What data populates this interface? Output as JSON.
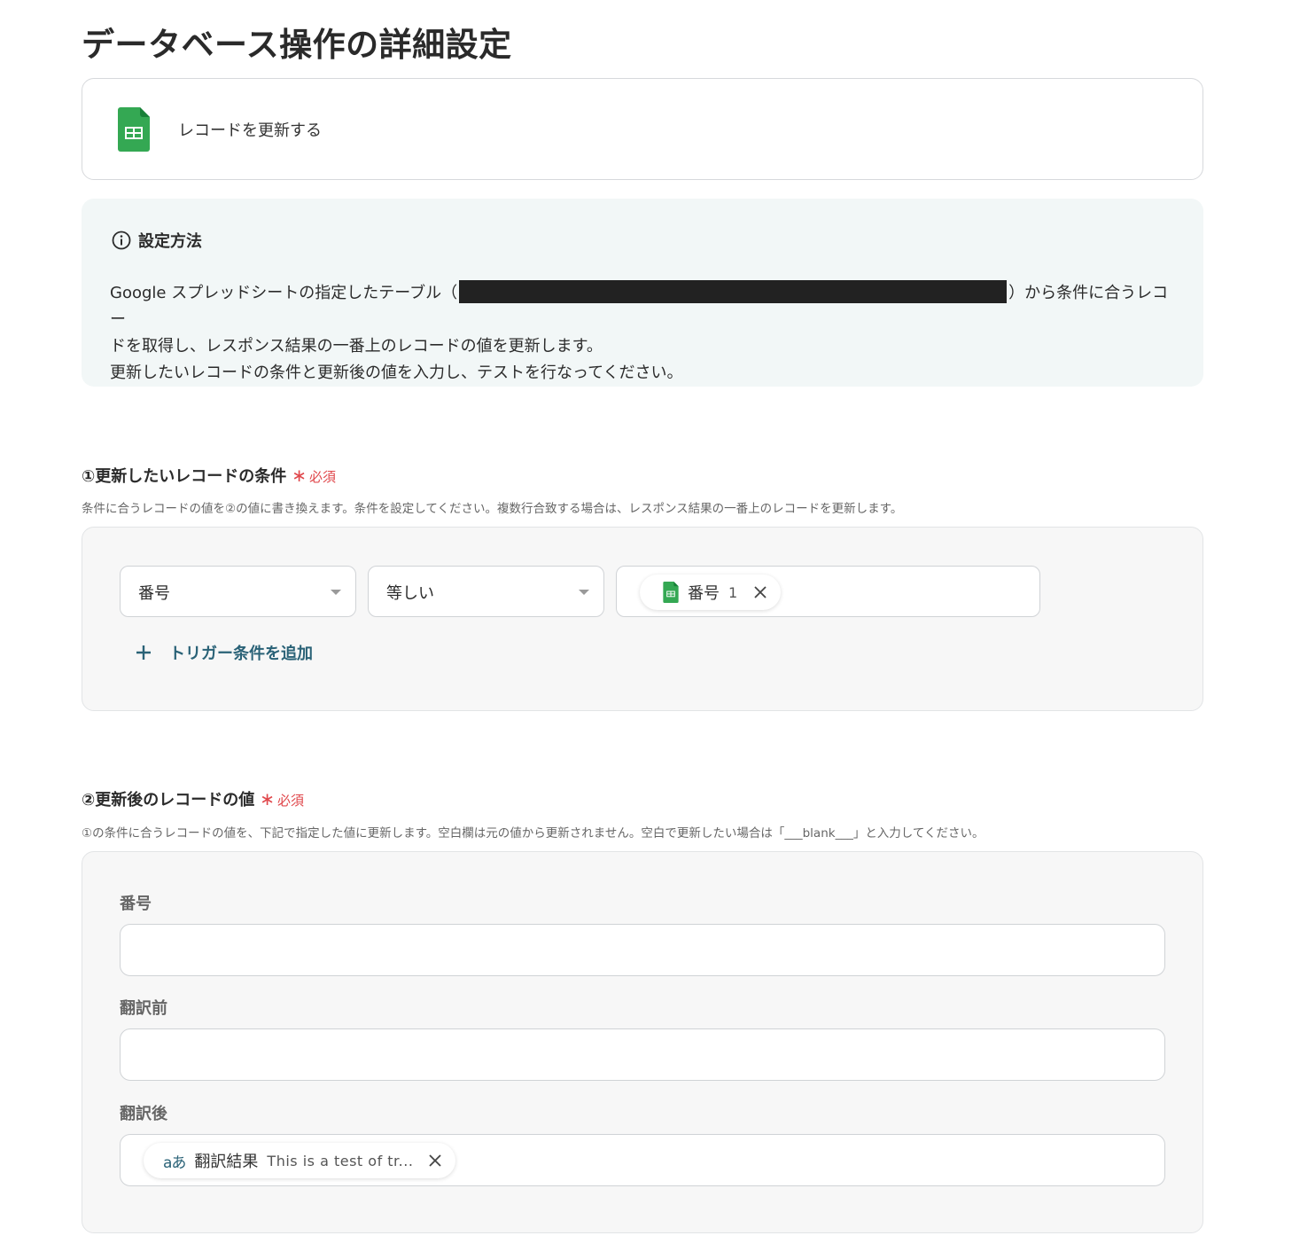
{
  "page": {
    "title": "データベース操作の詳細設定"
  },
  "action": {
    "label": "レコードを更新する",
    "icon": "google-sheets-icon"
  },
  "info": {
    "title": "設定方法",
    "line1_before": "Google スプレッドシートの指定したテーブル（",
    "line1_after": "）から条件に合うレコー",
    "line2": "ドを取得し、レスポンス結果の一番上のレコードの値を更新します。",
    "line3": "更新したいレコードの条件と更新後の値を入力し、テストを行なってください。"
  },
  "section1": {
    "title": "①更新したいレコードの条件",
    "required_star": "∗",
    "required": "必須",
    "description": "条件に合うレコードの値を②の値に書き換えます。条件を設定してください。複数行合致する場合は、レスポンス結果の一番上のレコードを更新します。",
    "condition": {
      "field": "番号",
      "operator": "等しい",
      "value_chip": {
        "label": "番号",
        "value": "1",
        "icon": "google-sheets-icon"
      }
    },
    "add_condition": "トリガー条件を追加"
  },
  "section2": {
    "title": "②更新後のレコードの値",
    "required_star": "∗",
    "required": "必須",
    "description": "①の条件に合うレコードの値を、下記で指定した値に更新します。空白欄は元の値から更新されません。空白で更新したい場合は「___blank___」と入力してください。",
    "fields": [
      {
        "label": "番号",
        "value": ""
      },
      {
        "label": "翻訳前",
        "value": ""
      },
      {
        "label": "翻訳後",
        "chip": {
          "label": "翻訳結果",
          "value": "This is a test of tr...",
          "icon": "translate-icon"
        }
      }
    ]
  }
}
